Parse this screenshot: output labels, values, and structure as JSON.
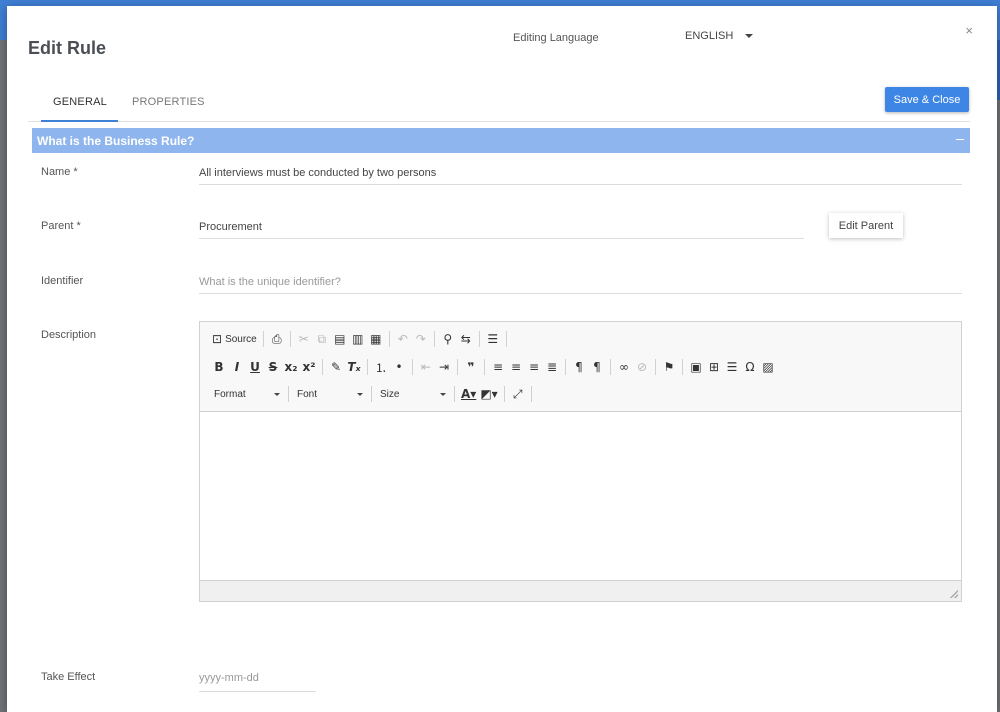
{
  "dialog": {
    "title": "Edit Rule",
    "editing_language_label": "Editing Language",
    "language_value": "ENGLISH",
    "close_glyph": "×"
  },
  "tabs": [
    {
      "label": "GENERAL",
      "active": true
    },
    {
      "label": "PROPERTIES",
      "active": false
    }
  ],
  "save_close_label": "Save & Close",
  "section": {
    "title": "What is the Business Rule?",
    "collapse_glyph": "–"
  },
  "fields": {
    "name": {
      "label": "Name *",
      "value": "All interviews must be conducted by two persons"
    },
    "parent": {
      "label": "Parent  *",
      "value": "Procurement",
      "button_label": "Edit Parent"
    },
    "identifier": {
      "label": "Identifier",
      "placeholder": "What is the unique identifier?"
    },
    "description": {
      "label": "Description"
    },
    "take_effect": {
      "label": "Take Effect",
      "placeholder": "yyyy-mm-dd"
    }
  },
  "editor_toolbar": {
    "source_label": "Source",
    "format_label": "Format",
    "font_label": "Font",
    "size_label": "Size"
  },
  "colors": {
    "accent": "#3d86e6",
    "section_bar": "#8fb5ee",
    "header_bg": "#3f7fd6"
  }
}
